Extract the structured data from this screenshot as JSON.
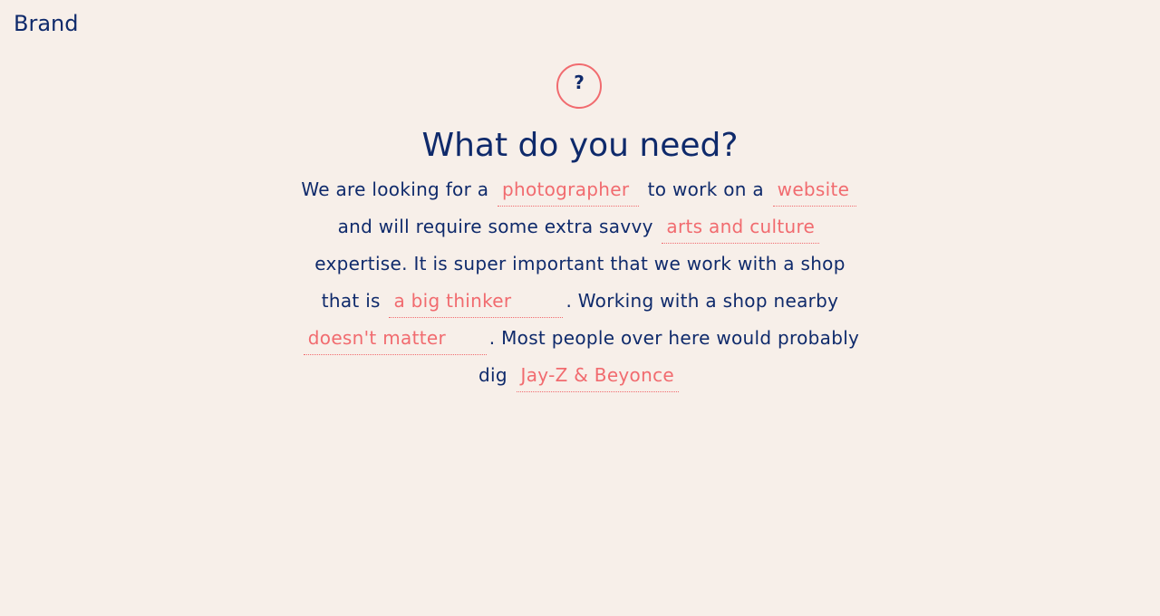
{
  "brand": "Brand",
  "help_icon_glyph": "?",
  "title": "What do you need?",
  "colors": {
    "background": "#f7efe9",
    "text": "#0f2a6b",
    "accent": "#f16b6f"
  },
  "madlib": {
    "t1": "We are looking for a",
    "role": "photographer",
    "t2": "to work on a",
    "project": "website",
    "t3": "and will require some extra savvy",
    "industry": "arts and culture",
    "t4": "expertise. It is super important that we work with a shop that is",
    "trait": "a big thinker",
    "t5": ". Working with a shop nearby",
    "location": "doesn't matter",
    "t6": ". Most people over here would probably dig",
    "celebrity": "Jay-Z & Beyonce"
  }
}
